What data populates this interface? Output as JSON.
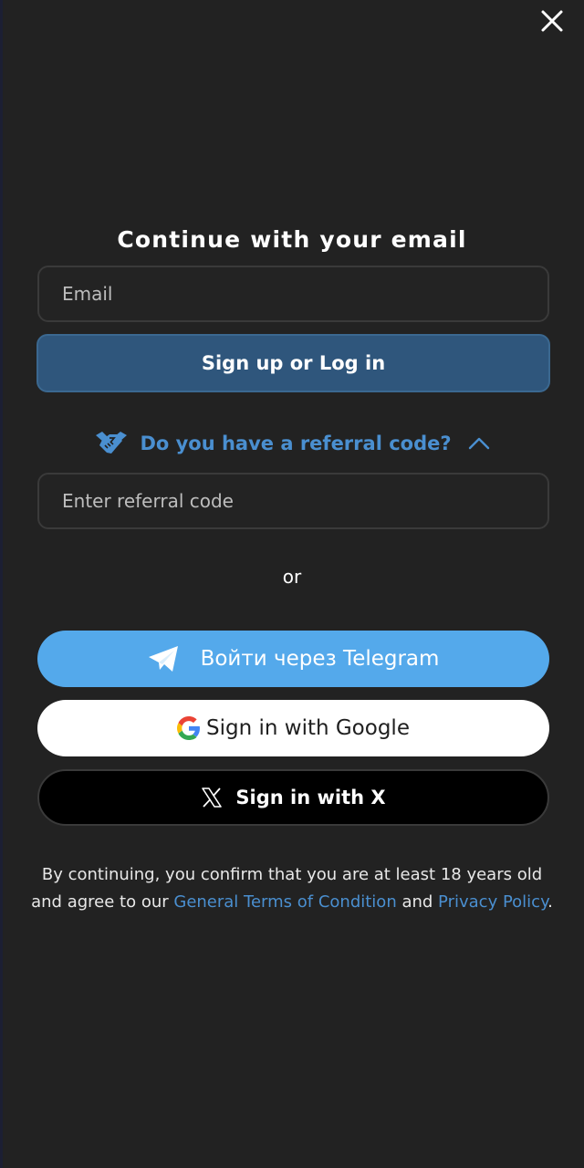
{
  "close": {
    "icon": "close-icon"
  },
  "title": "Continue with your email",
  "email": {
    "placeholder": "Email",
    "value": ""
  },
  "primary_button": {
    "label": "Sign up or Log in"
  },
  "referral": {
    "toggle_label": "Do you have a referral code?",
    "hand_icon": "handshake-icon",
    "chevron_icon": "chevron-up-icon",
    "placeholder": "Enter referral code",
    "value": ""
  },
  "or_label": "or",
  "social": {
    "telegram": {
      "label": "Войти через Telegram",
      "icon": "telegram-icon"
    },
    "google": {
      "label": "Sign in with Google",
      "icon": "google-icon"
    },
    "x": {
      "label": "Sign in with X",
      "icon": "x-logo-icon"
    }
  },
  "disclaimer": {
    "text_before": "By continuing, you confirm that you are at least 18 years old and agree to our ",
    "terms_link": "General Terms of Condition",
    "text_middle": " and ",
    "privacy_link": "Privacy Policy",
    "text_after": "."
  },
  "colors": {
    "background": "#222222",
    "primary_button": "#2f567c",
    "link": "#4a8fd0",
    "telegram": "#54a9eb",
    "google_button": "#ffffff",
    "x_button": "#000000"
  }
}
